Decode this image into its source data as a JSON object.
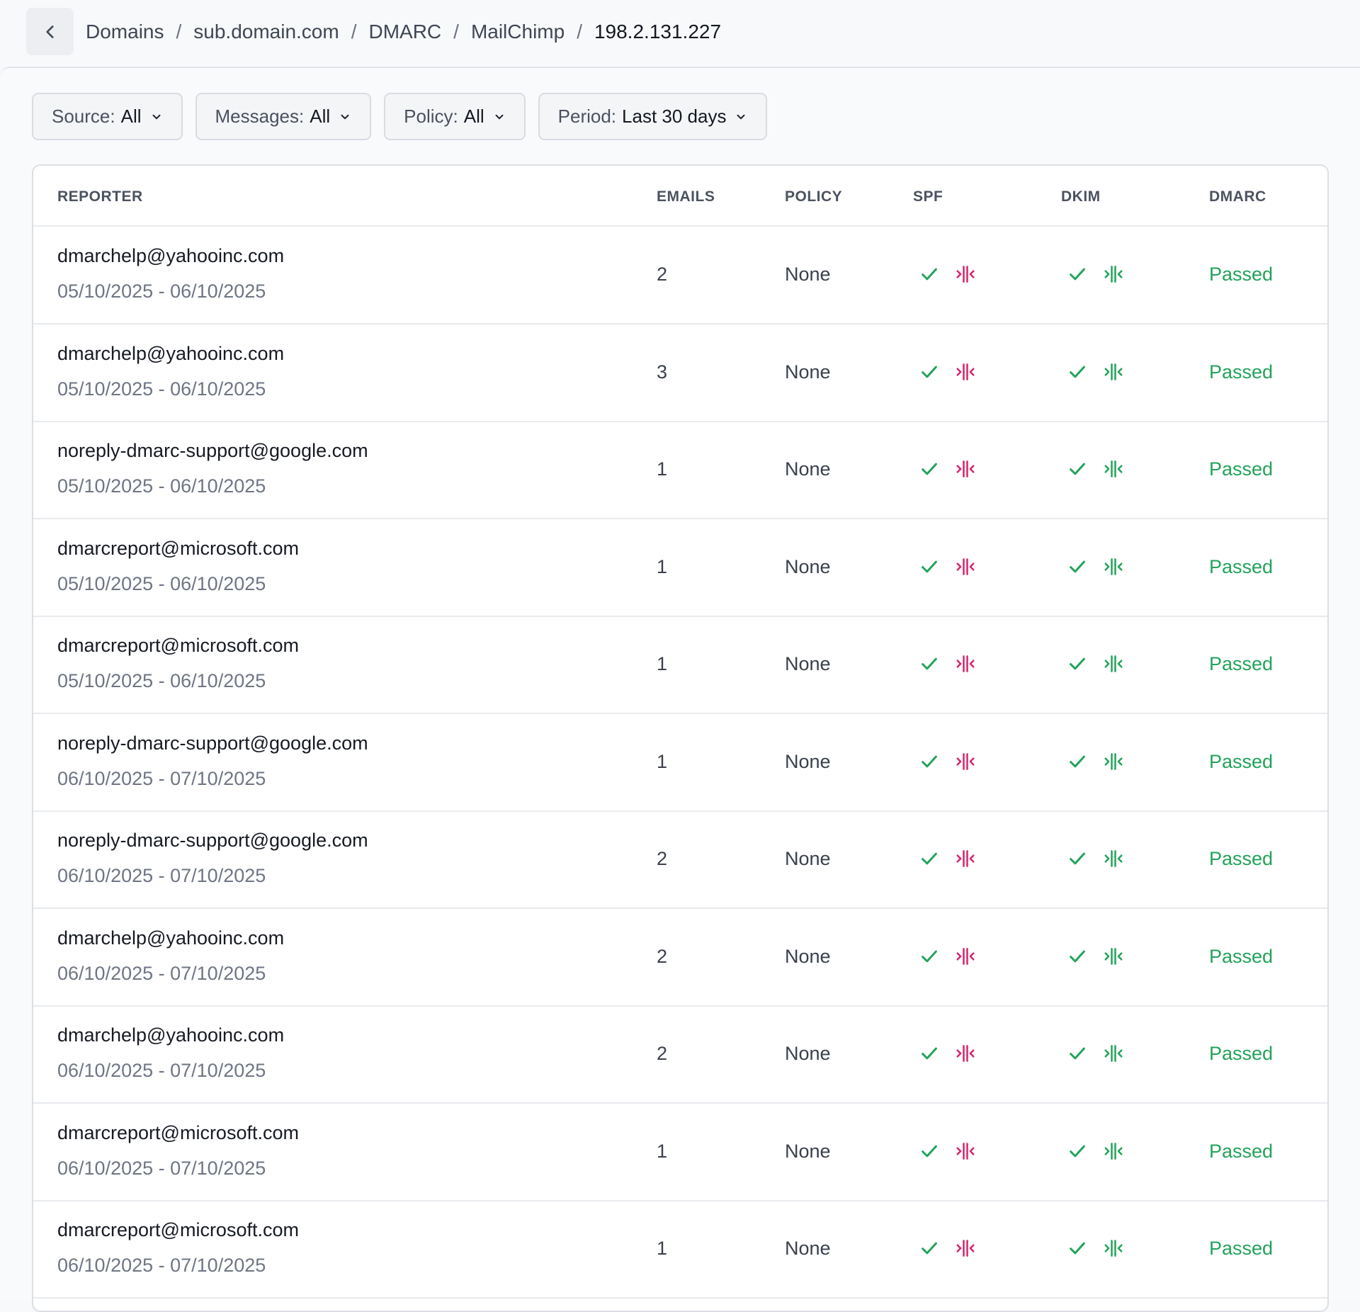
{
  "breadcrumb": {
    "items": [
      "Domains",
      "sub.domain.com",
      "DMARC",
      "MailChimp"
    ],
    "current": "198.2.131.227",
    "separator": "/"
  },
  "filters": [
    {
      "label": "Source:",
      "value": "All"
    },
    {
      "label": "Messages:",
      "value": "All"
    },
    {
      "label": "Policy:",
      "value": "All"
    },
    {
      "label": "Period:",
      "value": "Last 30 days"
    }
  ],
  "table": {
    "columns": [
      "REPORTER",
      "EMAILS",
      "POLICY",
      "SPF",
      "DKIM",
      "DMARC"
    ],
    "rows": [
      {
        "reporter": "dmarchelp@yahooinc.com",
        "period": "05/10/2025 - 06/10/2025",
        "emails": "2",
        "policy": "None",
        "dmarc": "Passed"
      },
      {
        "reporter": "dmarchelp@yahooinc.com",
        "period": "05/10/2025 - 06/10/2025",
        "emails": "3",
        "policy": "None",
        "dmarc": "Passed"
      },
      {
        "reporter": "noreply-dmarc-support@google.com",
        "period": "05/10/2025 - 06/10/2025",
        "emails": "1",
        "policy": "None",
        "dmarc": "Passed"
      },
      {
        "reporter": "dmarcreport@microsoft.com",
        "period": "05/10/2025 - 06/10/2025",
        "emails": "1",
        "policy": "None",
        "dmarc": "Passed"
      },
      {
        "reporter": "dmarcreport@microsoft.com",
        "period": "05/10/2025 - 06/10/2025",
        "emails": "1",
        "policy": "None",
        "dmarc": "Passed"
      },
      {
        "reporter": "noreply-dmarc-support@google.com",
        "period": "06/10/2025 - 07/10/2025",
        "emails": "1",
        "policy": "None",
        "dmarc": "Passed"
      },
      {
        "reporter": "noreply-dmarc-support@google.com",
        "period": "06/10/2025 - 07/10/2025",
        "emails": "2",
        "policy": "None",
        "dmarc": "Passed"
      },
      {
        "reporter": "dmarchelp@yahooinc.com",
        "period": "06/10/2025 - 07/10/2025",
        "emails": "2",
        "policy": "None",
        "dmarc": "Passed"
      },
      {
        "reporter": "dmarchelp@yahooinc.com",
        "period": "06/10/2025 - 07/10/2025",
        "emails": "2",
        "policy": "None",
        "dmarc": "Passed"
      },
      {
        "reporter": "dmarcreport@microsoft.com",
        "period": "06/10/2025 - 07/10/2025",
        "emails": "1",
        "policy": "None",
        "dmarc": "Passed"
      },
      {
        "reporter": "dmarcreport@microsoft.com",
        "period": "06/10/2025 - 07/10/2025",
        "emails": "1",
        "policy": "None",
        "dmarc": "Passed"
      }
    ]
  },
  "icons": {
    "check": {
      "name": "check-icon",
      "color": "#22a35a"
    },
    "spf_alignment": {
      "name": "alignment-icon",
      "color": "#d6246e"
    },
    "dkim_alignment": {
      "name": "alignment-icon",
      "color": "#22a35a"
    }
  },
  "colors": {
    "passed": "#22a35a",
    "misaligned": "#d6246e"
  }
}
